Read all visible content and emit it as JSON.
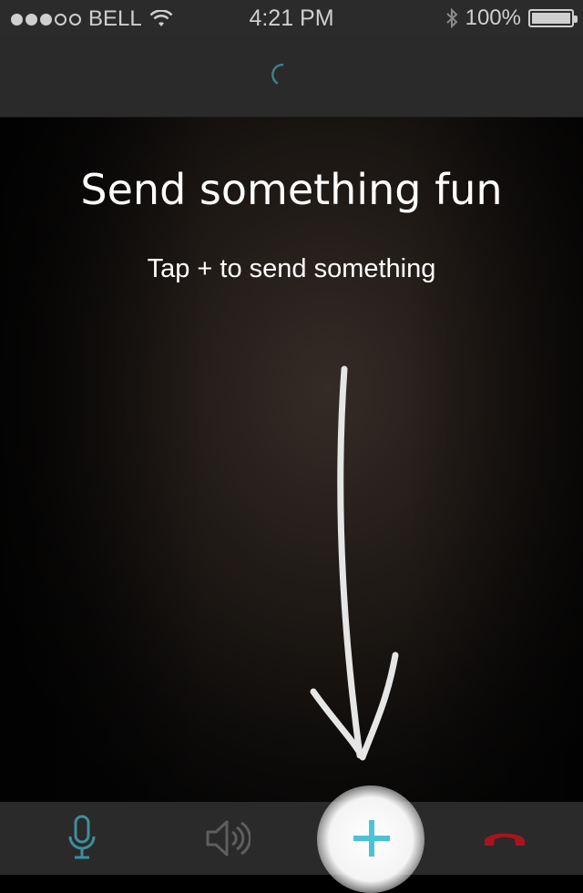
{
  "status_bar": {
    "carrier": "BELL",
    "time": "4:21 PM",
    "battery": "100%",
    "signal_filled": 3,
    "signal_total": 5
  },
  "header": {
    "loading_icon": "spinner-icon"
  },
  "video": {
    "title": "Send something fun",
    "subtitle": "Tap + to send something"
  },
  "toolbar": {
    "items": [
      {
        "name": "microphone-icon",
        "color": "#4aa6b5"
      },
      {
        "name": "speaker-icon",
        "color": "#6a6a6a"
      },
      {
        "name": "plus-icon",
        "color": "#4cc3d4"
      },
      {
        "name": "end-call-icon",
        "color": "#b0202a"
      }
    ]
  }
}
